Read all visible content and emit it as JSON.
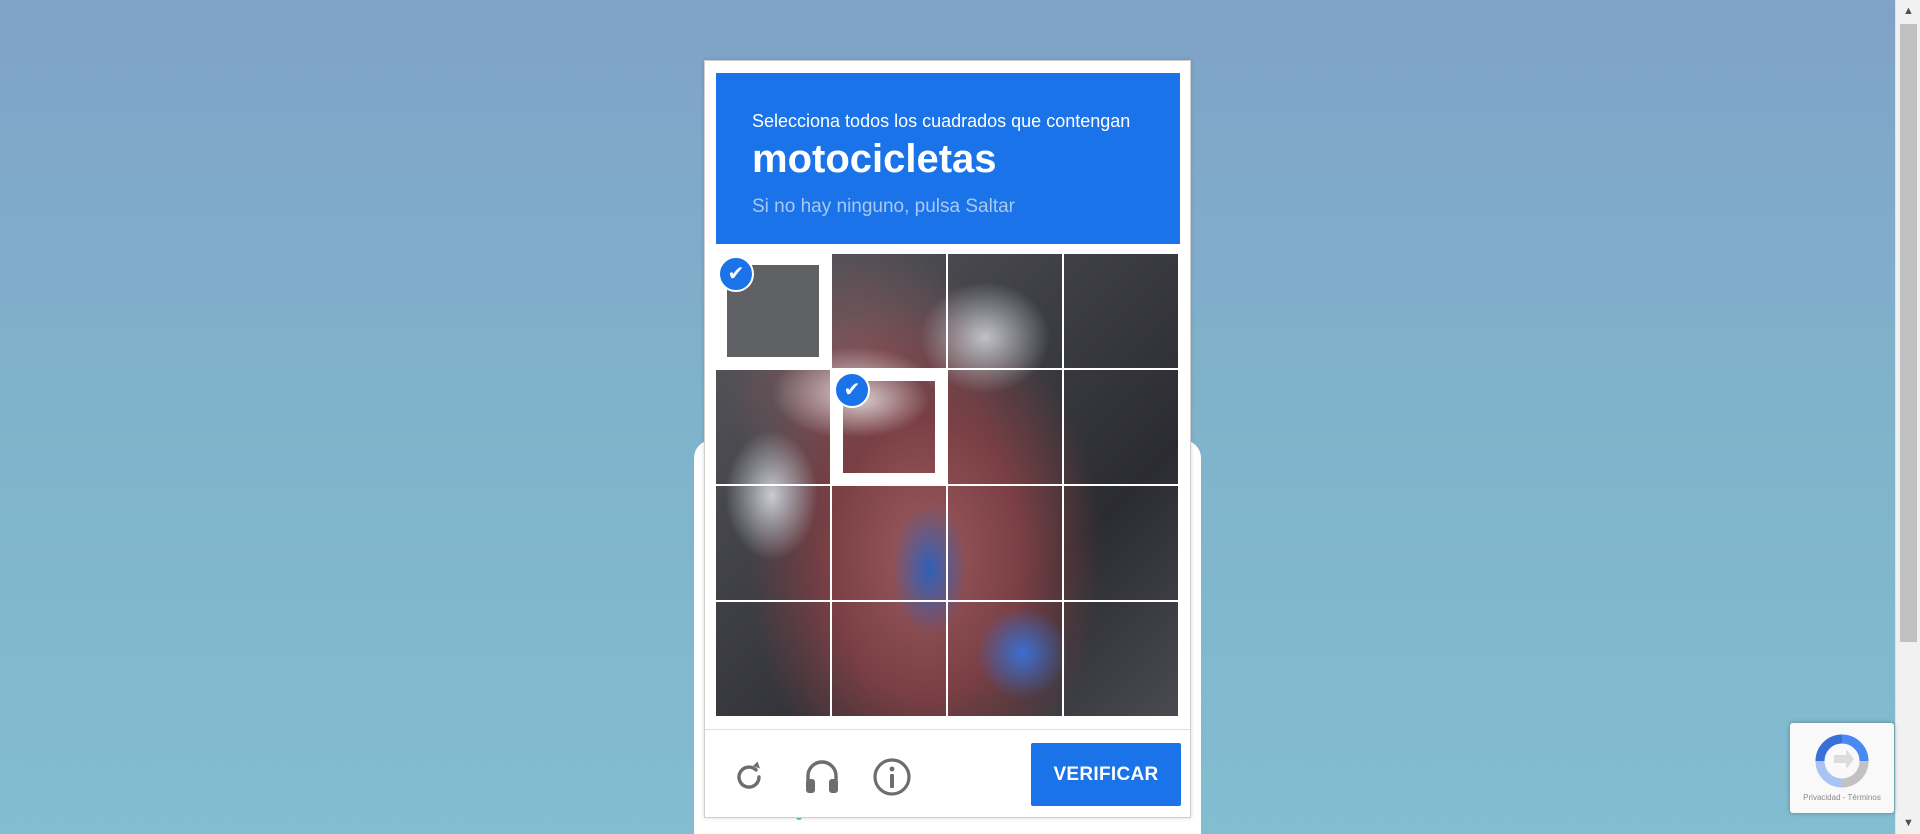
{
  "challenge": {
    "instruction": "Selecciona todos los cuadrados que contengan",
    "target": "motocicletas",
    "hint": "Si no hay ninguno, pulsa Saltar"
  },
  "grid": {
    "rows": 4,
    "cols": 4,
    "selected_tiles": [
      0,
      5
    ]
  },
  "footer": {
    "reload_icon": "reload-icon",
    "audio_icon": "headphones-icon",
    "info_icon": "info-icon",
    "verify_label": "VERIFICAR"
  },
  "badge": {
    "text": "Privacidad - Términos"
  },
  "colors": {
    "accent": "#1a73e8",
    "hint": "#a9c9f4"
  }
}
